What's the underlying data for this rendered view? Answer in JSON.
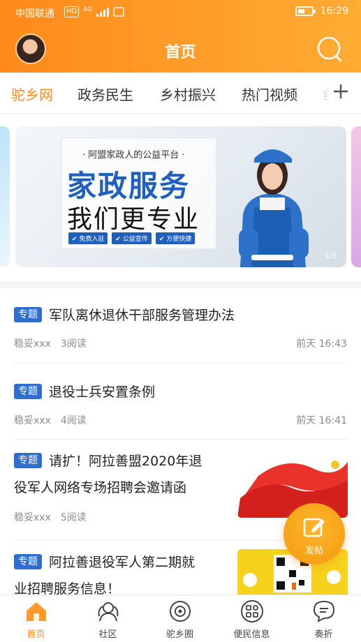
{
  "status_bar": {
    "carrier": "中国联通",
    "hd": "HD",
    "network": "4G",
    "time": "16:29"
  },
  "header": {
    "title": "首页"
  },
  "tabs": [
    {
      "label": "驼乡网",
      "active": true
    },
    {
      "label": "政务民生",
      "active": false
    },
    {
      "label": "乡村振兴",
      "active": false
    },
    {
      "label": "热门视频",
      "active": false
    },
    {
      "label": "纟",
      "active": false
    }
  ],
  "banner": {
    "subtitle": "· 阿盟家政人的公益平台 ·",
    "headline": "家政服务",
    "headline2": "我们更专业",
    "tags": [
      "✔ 免费入驻",
      "✔ 公益宣传",
      "✔ 方便快捷"
    ],
    "counter": "1/3"
  },
  "feed": [
    {
      "tag": "专题",
      "title_lines": [
        "军队离休退休干部服务管理办法"
      ],
      "author": "稳妥xxx",
      "reads": "3阅读",
      "time": "前天 16:43"
    },
    {
      "tag": "专题",
      "title_lines": [
        "退役士兵安置条例"
      ],
      "author": "稳妥xxx",
      "reads": "4阅读",
      "time": "前天 16:41"
    },
    {
      "tag": "专题",
      "title_lines": [
        "请扩！阿拉善盟2020年退",
        "役军人网络专场招聘会邀请函"
      ],
      "author": "稳妥xxx",
      "reads": "5阅读",
      "time": ""
    },
    {
      "tag": "专题",
      "title_lines": [
        "阿拉善退役军人第二期就",
        "业招聘服务信息！"
      ],
      "author": "",
      "reads": "",
      "time": ""
    }
  ],
  "fab": {
    "label": "发帖"
  },
  "bottom_nav": [
    {
      "label": "首页",
      "icon": "home-icon",
      "active": true
    },
    {
      "label": "社区",
      "icon": "community-icon",
      "active": false
    },
    {
      "label": "驼乡圈",
      "icon": "circle-icon",
      "active": false
    },
    {
      "label": "便民信息",
      "icon": "grid-icon",
      "active": false
    },
    {
      "label": "奏折",
      "icon": "message-icon",
      "active": false
    }
  ],
  "colors": {
    "accent": "#ff8a1a",
    "tag_blue": "#2f6ecf",
    "fab": "#f7a21c"
  }
}
